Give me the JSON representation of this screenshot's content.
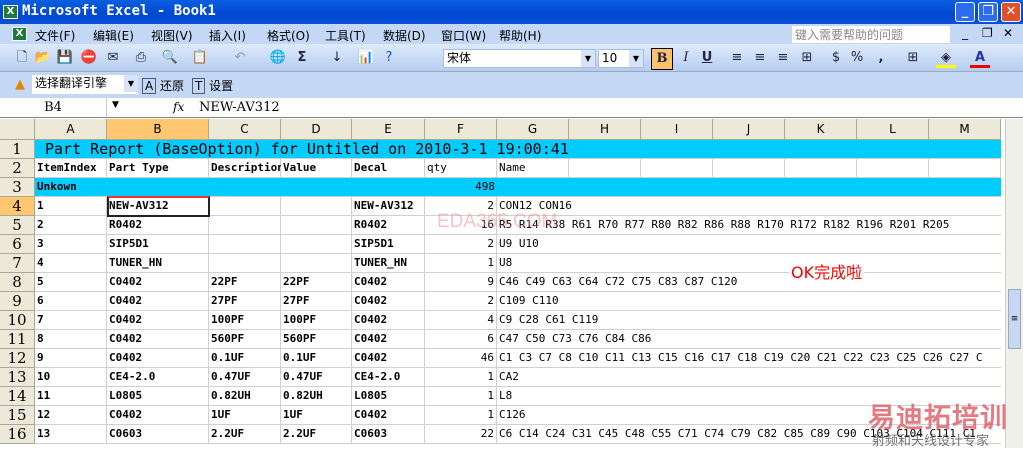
{
  "window": {
    "title": "Microsoft Excel - Book1",
    "app_icon": "excel-icon"
  },
  "menu": [
    "文件(F)",
    "编辑(E)",
    "视图(V)",
    "插入(I)",
    "格式(O)",
    "工具(T)",
    "数据(D)",
    "窗口(W)",
    "帮助(H)"
  ],
  "help_placeholder": "键入需要帮助的问题",
  "font_name": "宋体",
  "font_size": "10",
  "translate": {
    "engine": "选择翻译引擎",
    "restore": "还原",
    "settings": "设置"
  },
  "formula_bar": {
    "name_box": "B4",
    "fx": "fx",
    "value": "NEW-AV312"
  },
  "columns": [
    "A",
    "B",
    "C",
    "D",
    "E",
    "F",
    "G",
    "H",
    "I",
    "J",
    "K",
    "L",
    "M"
  ],
  "row_numbers": [
    "1",
    "2",
    "3",
    "4",
    "5",
    "6",
    "7",
    "8",
    "9",
    "10",
    "11",
    "12",
    "13",
    "14",
    "15",
    "16"
  ],
  "title_row": "Part Report (BaseOption) for Untitled on 2010-3-1 19:00:41",
  "headers": [
    "ItemIndex",
    "Part Type",
    "Description",
    "Value",
    "Decal",
    "qty",
    "Name"
  ],
  "group": {
    "label": "Unkown",
    "qty": "498"
  },
  "rows": [
    [
      "1",
      "NEW-AV312",
      "",
      "",
      "NEW-AV312",
      "2",
      "CON12 CON16"
    ],
    [
      "2",
      "R0402",
      "",
      "",
      "R0402",
      "16",
      "R5 R14 R38 R61 R70 R77 R80 R82 R86 R88 R170 R172 R182 R196 R201 R205"
    ],
    [
      "3",
      "SIP5D1",
      "",
      "",
      "SIP5D1",
      "2",
      "U9 U10"
    ],
    [
      "4",
      "TUNER_HN",
      "",
      "",
      "TUNER_HN",
      "1",
      "U8"
    ],
    [
      "5",
      "C0402",
      "22PF",
      "22PF",
      "C0402",
      "9",
      "C46 C49 C63 C64 C72 C75 C83 C87 C120"
    ],
    [
      "6",
      "C0402",
      "27PF",
      "27PF",
      "C0402",
      "2",
      "C109 C110"
    ],
    [
      "7",
      "C0402",
      "100PF",
      "100PF",
      "C0402",
      "4",
      "C9 C28 C61 C119"
    ],
    [
      "8",
      "C0402",
      "560PF",
      "560PF",
      "C0402",
      "6",
      "C47 C50 C73 C76 C84 C86"
    ],
    [
      "9",
      "C0402",
      "0.1UF",
      "0.1UF",
      "C0402",
      "46",
      "C1 C3 C7 C8 C10 C11 C13 C15 C16 C17 C18 C19 C20 C21 C22 C23 C25 C26 C27 C"
    ],
    [
      "10",
      "CE4-2.0",
      "0.47UF",
      "0.47UF",
      "CE4-2.0",
      "1",
      "CA2"
    ],
    [
      "11",
      "L0805",
      "0.82UH",
      "0.82UH",
      "L0805",
      "1",
      "L8"
    ],
    [
      "12",
      "C0402",
      "1UF",
      "1UF",
      "C0402",
      "1",
      "C126"
    ],
    [
      "13",
      "C0603",
      "2.2UF",
      "2.2UF",
      "C0603",
      "22",
      "C6 C14 C24 C31 C45 C48 C55 C71 C74 C79 C82 C85 C89 C90 C103 C104 C111 C1"
    ]
  ],
  "overlays": {
    "watermark": "EDA365.COM",
    "note": "OK完成啦",
    "logo": "易迪拓培训",
    "logo_sub": "射频和天线设计专家"
  },
  "colors": {
    "header_fill": "#00ccff",
    "note": "#ff0000"
  }
}
